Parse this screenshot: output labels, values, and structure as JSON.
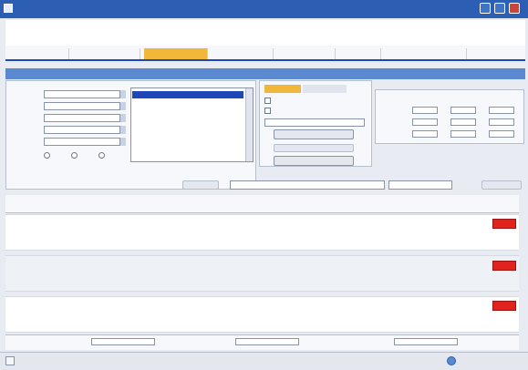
{
  "window": {
    "title": ""
  },
  "app": {
    "logo_text": "",
    "top_link": ""
  },
  "nav": {
    "tabs": [
      {
        "label": ""
      },
      {
        "label": ""
      },
      {
        "label": ""
      },
      {
        "label": ""
      },
      {
        "label": ""
      },
      {
        "label": ""
      },
      {
        "label": ""
      }
    ],
    "active_index": 2
  },
  "page": {
    "title": ""
  },
  "filters": {
    "rows": [
      {
        "label": "",
        "value": ""
      },
      {
        "label": "",
        "value": ""
      },
      {
        "label": "",
        "value": ""
      },
      {
        "label": "",
        "value": ""
      },
      {
        "label": "",
        "value": ""
      }
    ],
    "select_all_header": "",
    "select_none_header": "",
    "list_rows": [
      "",
      "",
      "",
      "",
      "",
      "",
      ""
    ],
    "selected_list_index": 0
  },
  "options": {
    "tabs": [
      {
        "label": ""
      },
      {
        "label": ""
      }
    ],
    "checkboxes": [
      "",
      ""
    ],
    "dropdown_value": "",
    "primary_button": "",
    "secondary_button": "",
    "clear_button": ""
  },
  "summary": {
    "columns": [
      "",
      "",
      ""
    ],
    "rows": [
      {
        "label": "",
        "values": [
          "",
          "",
          ""
        ]
      },
      {
        "label": "",
        "values": [
          "",
          "",
          ""
        ]
      },
      {
        "label": "",
        "values": [
          "",
          "",
          ""
        ]
      }
    ]
  },
  "toolbar": {
    "select_project": "",
    "route_select": "",
    "left_button": "",
    "right_button": "",
    "select_all": "",
    "clear_selection": ""
  },
  "grid": {
    "headers": [
      "",
      "",
      "",
      "",
      "",
      "",
      "",
      "",
      "",
      "",
      ""
    ],
    "records": [
      {
        "ref": "",
        "date": "",
        "tag": "",
        "description": "",
        "qty1": "",
        "qty2": "",
        "interval": "",
        "num1": "",
        "num2": "",
        "date2": "",
        "due": ""
      },
      {
        "ref": "",
        "date": "",
        "tag": "",
        "description": "",
        "qty1": "",
        "qty2": "",
        "interval": "",
        "num1": "",
        "num2": "",
        "date2": "",
        "due": ""
      },
      {
        "ref": "",
        "date": "",
        "tag": "",
        "description": "",
        "qty1": "",
        "qty2": "",
        "interval": "",
        "num1": "",
        "num2": "",
        "date2": "",
        "due": ""
      }
    ]
  },
  "footer": {
    "label1": "",
    "value1": "",
    "label2": "",
    "value2": "",
    "label3": ""
  },
  "statusbar": {
    "zone": ""
  },
  "colors": {
    "accent": "#1e48b8",
    "active_tab": "#f1b73b",
    "alert": "#e2221c",
    "title_bar": "#2c5fb3"
  }
}
